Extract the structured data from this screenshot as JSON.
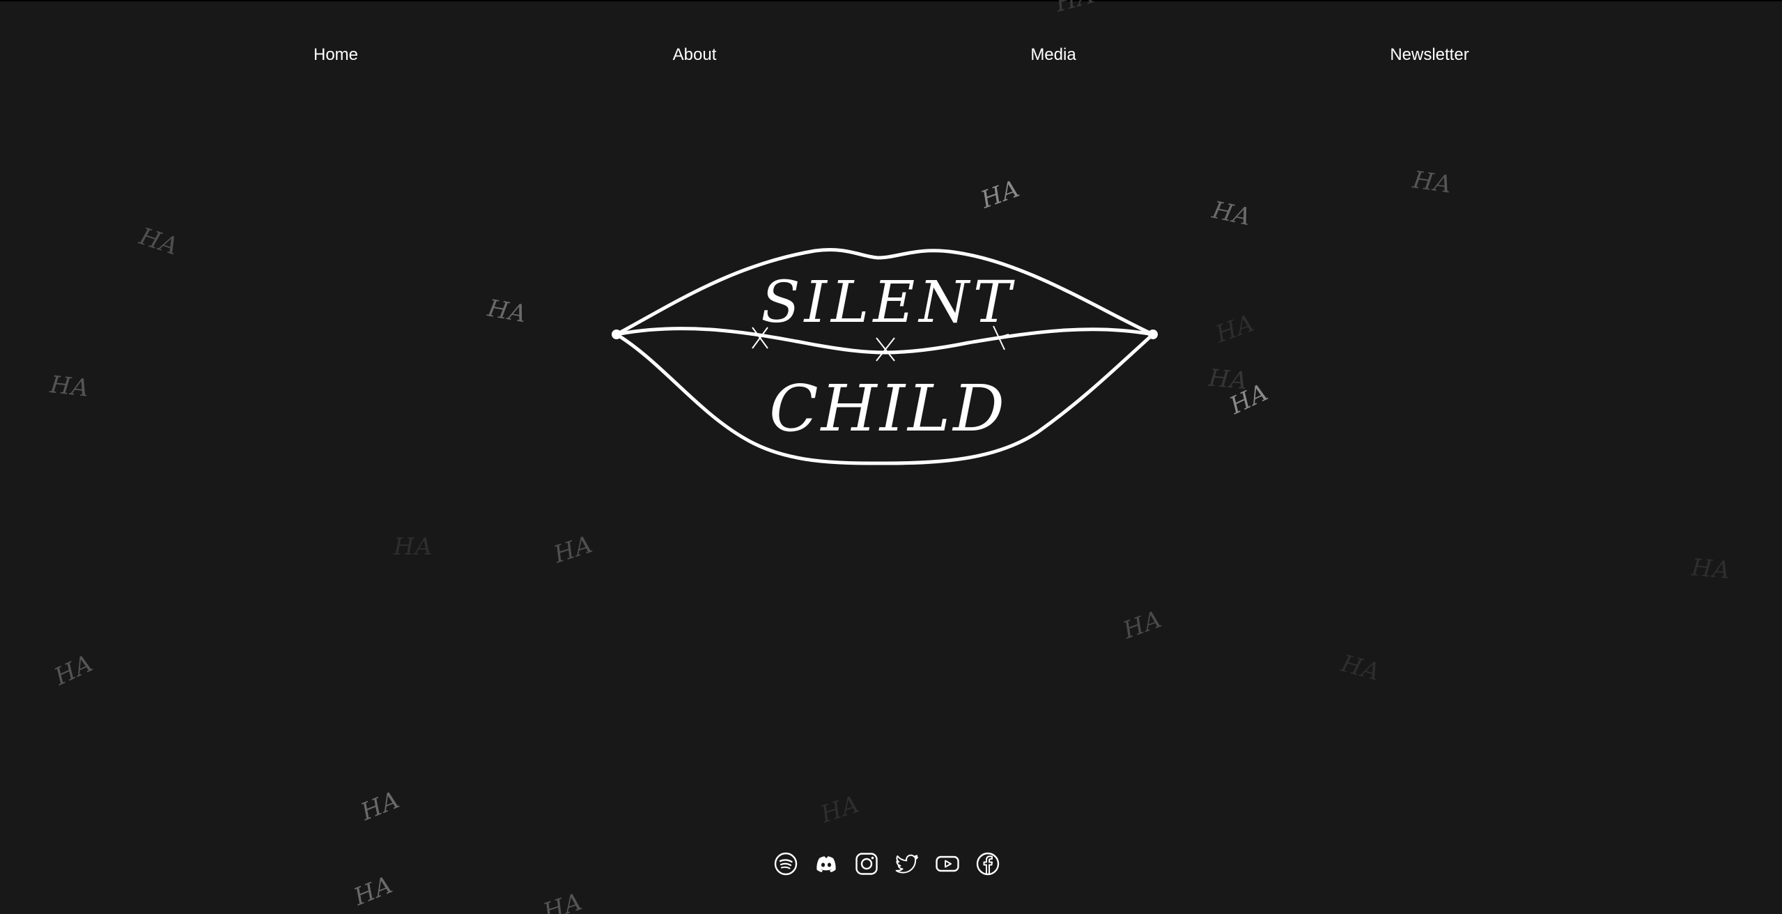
{
  "nav": {
    "items": [
      {
        "label": "Home"
      },
      {
        "label": "About"
      },
      {
        "label": "Media"
      },
      {
        "label": "Newsletter"
      }
    ]
  },
  "logo": {
    "line1": "SILENT",
    "line2": "CHILD"
  },
  "background": {
    "pattern_text": "HA"
  },
  "socials": [
    {
      "icon": "spotify-icon"
    },
    {
      "icon": "discord-icon"
    },
    {
      "icon": "instagram-icon"
    },
    {
      "icon": "twitter-icon"
    },
    {
      "icon": "youtube-icon"
    },
    {
      "icon": "facebook-icon"
    }
  ],
  "colors": {
    "background": "#181818",
    "text": "#ffffff"
  }
}
